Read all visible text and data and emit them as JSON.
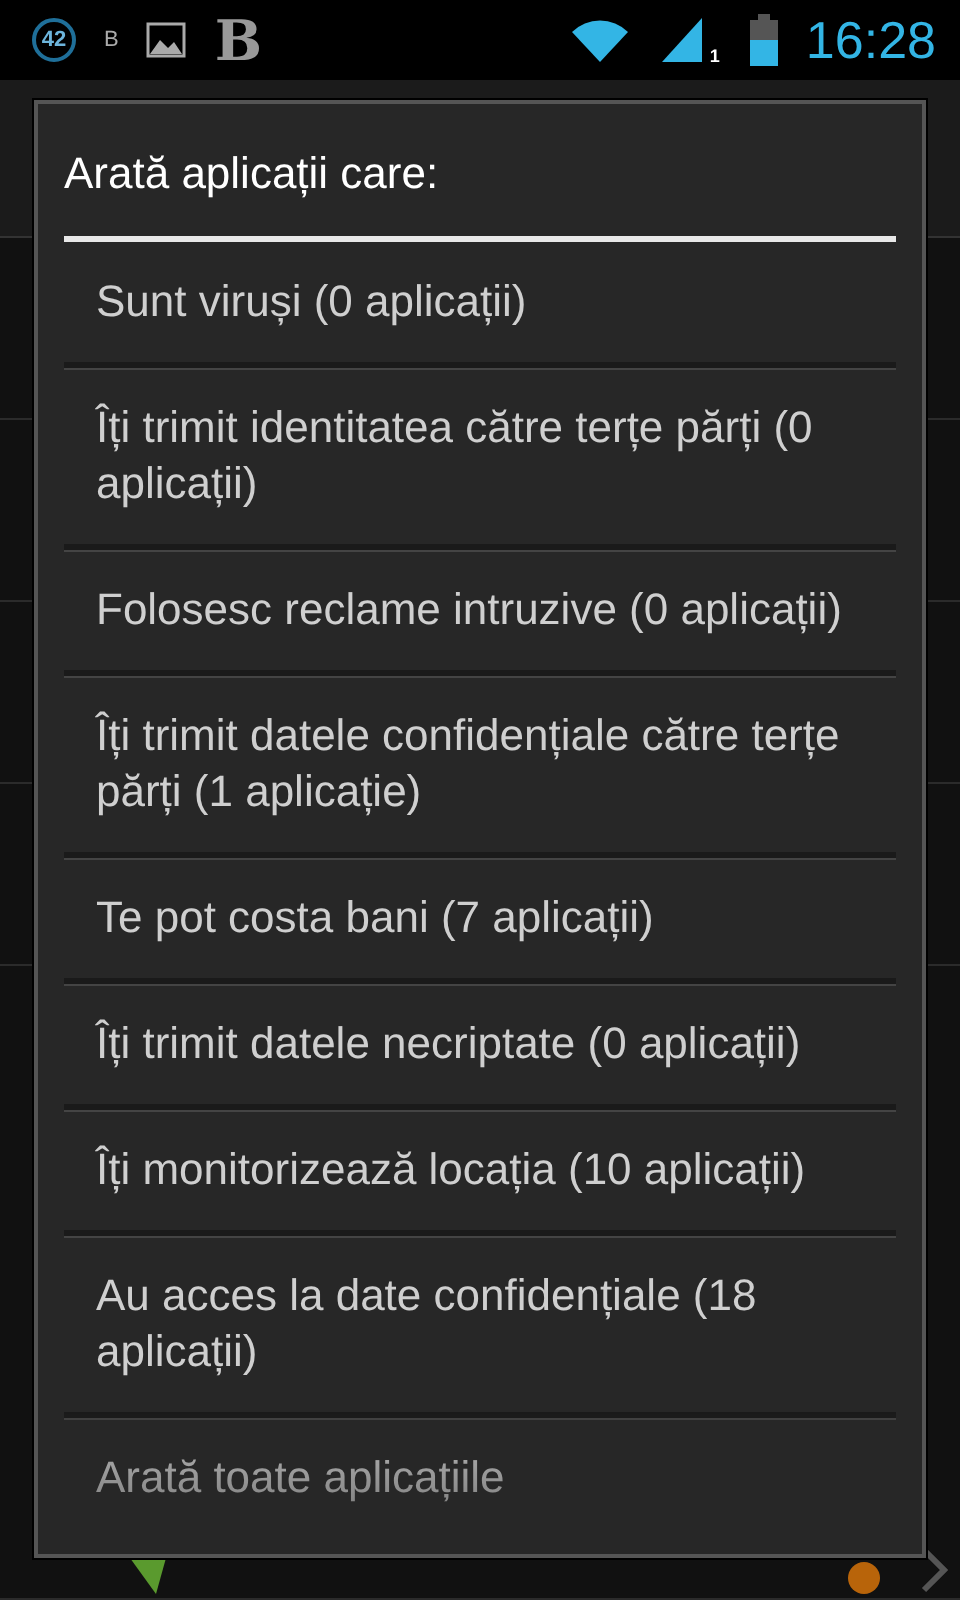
{
  "status_bar": {
    "notification_count": "42",
    "small_letter": "B",
    "big_letter": "B",
    "signal_sim": "1",
    "time": "16:28"
  },
  "background_list": {
    "rows": [
      {
        "color": "#b8640a"
      }
    ]
  },
  "dialog": {
    "title": "Arată aplicații care:",
    "items": [
      {
        "label": "Sunt viruși (0 aplicații)"
      },
      {
        "label": "Îți trimit identitatea către terțe părți (0 aplicații)"
      },
      {
        "label": "Folosesc reclame intruzive (0 aplicații)"
      },
      {
        "label": "Îți trimit datele confidențiale către terțe părți (1 aplicație)"
      },
      {
        "label": "Te pot costa bani (7 aplicații)"
      },
      {
        "label": "Îți trimit datele necriptate (0 aplicații)"
      },
      {
        "label": "Îți monitorizează locația (10 aplicații)"
      },
      {
        "label": "Au acces la date confidențiale (18 aplicații)"
      },
      {
        "label": "Arată toate aplicațiile"
      }
    ]
  }
}
